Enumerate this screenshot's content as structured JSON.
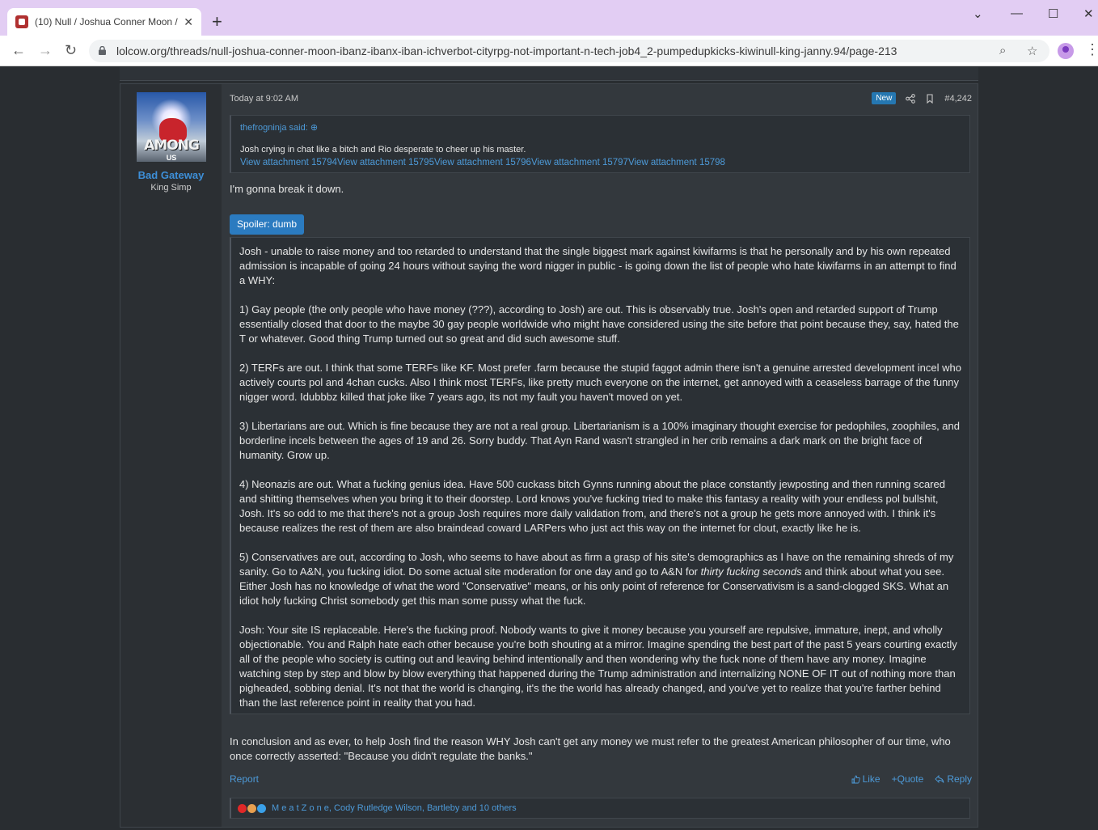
{
  "browser": {
    "tab_title": "(10) Null / Joshua Conner Moon / ",
    "tab_close": "✕",
    "new_tab": "+",
    "url": "lolcow.org/threads/null-joshua-conner-moon-ibanz-ibanx-iban-ichverbot-cityrpg-not-important-n-tech-job4_2-pumpedupkicks-kiwinull-king-janny.94/page-213",
    "window_controls": {
      "chevron": "⌄",
      "minimize": "—",
      "maximize": "☐",
      "close": "✕"
    },
    "nav": {
      "back": "←",
      "forward": "→",
      "reload": "↻"
    }
  },
  "post": {
    "author": {
      "avatar_text": "AMONG",
      "avatar_subtext": "US",
      "name": "Bad Gateway",
      "title": "King Simp"
    },
    "date": "Today at 9:02 AM",
    "badge": "New",
    "post_number": "#4,242",
    "quote": {
      "header": "thefrogninja said:",
      "text": "Josh crying in chat like a bitch and Rio desperate to cheer up his master.",
      "attachments": [
        "View attachment 15794",
        "View attachment 15795",
        "View attachment 15796",
        "View attachment 15797",
        "View attachment 15798"
      ]
    },
    "first_line": "I'm gonna break it down.",
    "spoiler_label": "Spoiler: dumb",
    "spoiler_paragraphs": [
      "Josh - unable to raise money and too retarded to understand that the single biggest mark against kiwifarms is that he personally and by his own repeated admission is incapable of going 24 hours without saying the word nigger in public - is going down the list of people who hate kiwifarms in an attempt to find a WHY:",
      "1) Gay people (the only people who have money (???), according to Josh) are out. This is observably true. Josh's open and retarded support of Trump essentially closed that door to the maybe 30 gay people worldwide who might have considered using the site before that point because they, say, hated the T or whatever. Good thing Trump turned out so great and did such awesome stuff.",
      "2) TERFs are out. I think that some TERFs like KF. Most prefer .farm because the stupid faggot admin there isn't a genuine arrested development incel who actively courts pol and 4chan cucks. Also I think most TERFs, like pretty much everyone on the internet, get annoyed with a ceaseless barrage of the funny nigger word. Idubbbz killed that joke like 7 years ago, its not my fault you haven't moved on yet.",
      "3) Libertarians are out. Which is fine because they are not a real group. Libertarianism is a 100% imaginary thought exercise for pedophiles, zoophiles, and borderline incels between the ages of 19 and 26. Sorry buddy. That Ayn Rand wasn't strangled in her crib remains a dark mark on the bright face of humanity. Grow up.",
      "4) Neonazis are out. What a fucking genius idea. Have 500 cuckass bitch Gynns running about the place constantly jewposting and then running scared and shitting themselves when you bring it to their doorstep. Lord knows you've fucking tried to make this fantasy a reality with your endless pol bullshit, Josh. It's so odd to me that there's not a group Josh requires more daily validation from, and there's not a group he gets more annoyed with. I think it's because realizes the rest of them are also braindead coward LARPers who just act this way on the internet for clout, exactly like he is."
    ],
    "p5": {
      "before": "5) Conservatives are out, according to Josh, who seems to have about as firm a grasp of his site's demographics as I have on the remaining shreds of my sanity. Go to A&N, you fucking idiot. Do some actual site moderation for one day and go to A&N for ",
      "italic": "thirty fucking seconds",
      "after": " and think about what you see. Either Josh has no knowledge of what the word \"Conservative\" means, or his only point of reference for Conservativism is a sand-clogged SKS. What an idiot holy fucking Christ somebody get this man some pussy what the fuck."
    },
    "last_paragraph": "Josh: Your site IS replaceable. Here's the fucking proof. Nobody wants to give it money because you yourself are repulsive, immature, inept, and wholly objectionable. You and Ralph hate each other because you're both shouting at a mirror. Imagine spending the best part of the past 5 years courting exactly all of the people who society is cutting out and leaving behind intentionally and then wondering why the fuck none of them have any money. Imagine watching step by step and blow by blow everything that happened during the Trump administration and internalizing NONE OF IT out of nothing more than pigheaded, sobbing denial. It's not that the world is changing, it's the the world has already changed, and you've yet to realize that you're farther behind than the last reference point in reality that you had.",
    "conclusion": "In conclusion and as ever, to help Josh find the reason WHY Josh can't get any money we must refer to the greatest American philosopher of our time, who once correctly asserted: \"Because you didn't regulate the banks.\"",
    "report": "Report",
    "actions": {
      "like": "Like",
      "quote": "+Quote",
      "reply": "Reply"
    },
    "reactions_text": "M e a t Z o n e, Cody Rutledge Wilson, Bartleby and 10 others",
    "reaction_colors": [
      "#e02828",
      "#e8a050",
      "#3aa0e8"
    ]
  }
}
